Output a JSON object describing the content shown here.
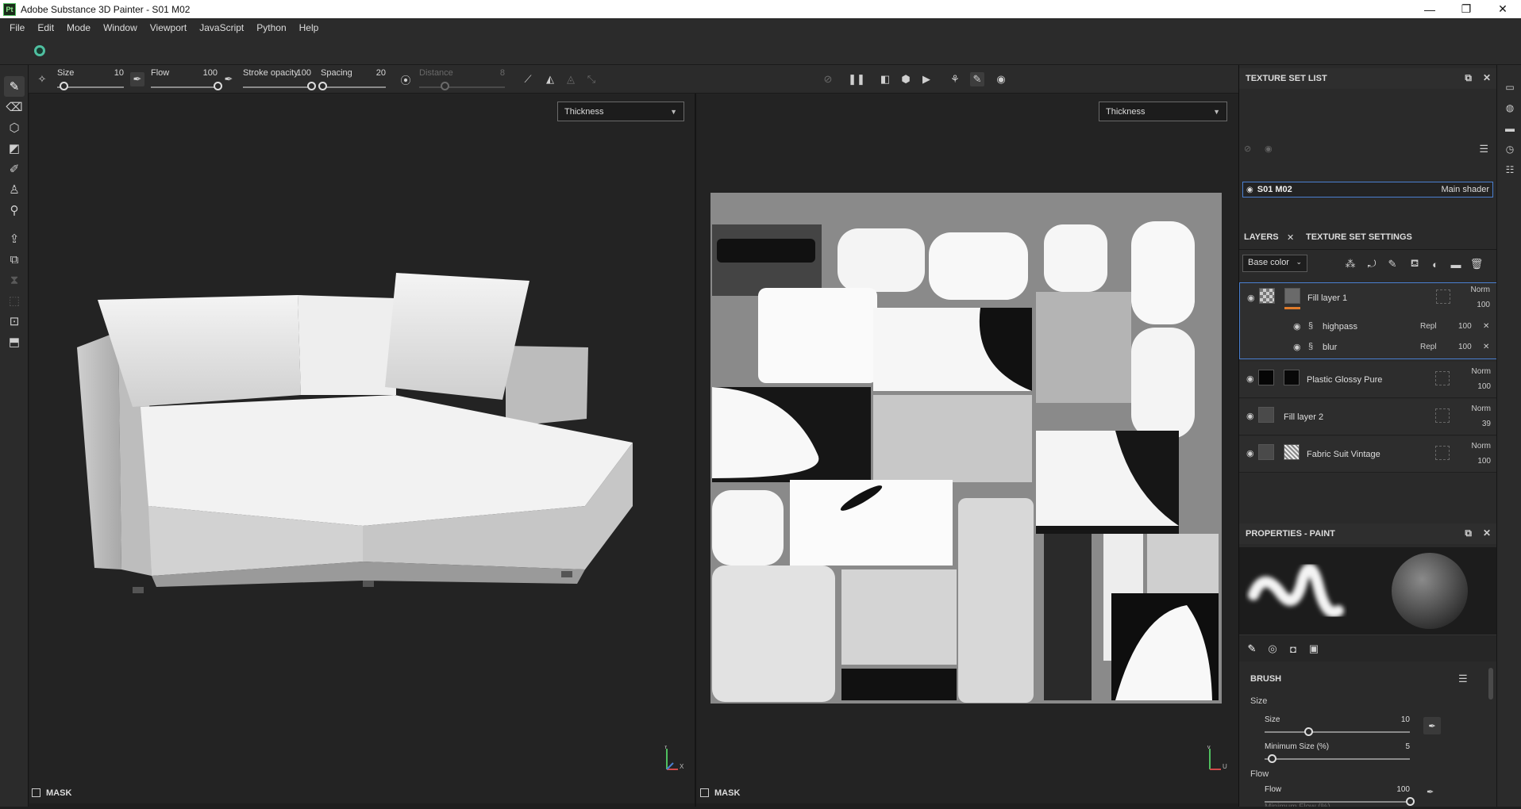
{
  "window": {
    "title": "Adobe Substance 3D Painter - S01 M02",
    "app_icon": "Pt",
    "minimize": "—",
    "maximize": "❐",
    "close": "✕"
  },
  "menu": [
    "File",
    "Edit",
    "Mode",
    "Window",
    "Viewport",
    "JavaScript",
    "Python",
    "Help"
  ],
  "toolbar": {
    "size": {
      "label": "Size",
      "value": "10",
      "level": 0.1
    },
    "flow": {
      "label": "Flow",
      "value": "100",
      "level": 1.0
    },
    "stroke_opacity": {
      "label": "Stroke opacity",
      "value": "100",
      "level": 1.0
    },
    "spacing": {
      "label": "Spacing",
      "value": "20",
      "level": 0.03
    },
    "distance": {
      "label": "Distance",
      "value": "8",
      "level": 0.3
    }
  },
  "viewports": {
    "left": {
      "channel": "Thickness",
      "mask_label": "MASK",
      "axis_y": "Y",
      "axis_x": "X"
    },
    "right": {
      "channel": "Thickness",
      "mask_label": "MASK",
      "axis_v": "V",
      "axis_u": "U"
    }
  },
  "texture_set_list": {
    "title": "TEXTURE SET LIST",
    "set_name": "S01 M02",
    "shader": "Main shader"
  },
  "layers_panel": {
    "tab_layers": "LAYERS",
    "tab_settings": "TEXTURE SET SETTINGS",
    "channel": "Base color",
    "layers": [
      {
        "name": "Fill layer 1",
        "blend": "Norm",
        "opacity": "100"
      },
      {
        "name": "Plastic Glossy Pure",
        "blend": "Norm",
        "opacity": "100"
      },
      {
        "name": "Fill layer 2",
        "blend": "Norm",
        "opacity": "39"
      },
      {
        "name": "Fabric Suit Vintage",
        "blend": "Norm",
        "opacity": "100"
      }
    ],
    "effects": [
      {
        "name": "highpass",
        "blend": "Repl",
        "opacity": "100"
      },
      {
        "name": "blur",
        "blend": "Repl",
        "opacity": "100"
      }
    ]
  },
  "properties": {
    "title": "PROPERTIES - PAINT",
    "section": "BRUSH",
    "size_group": "Size",
    "size": {
      "label": "Size",
      "value": "10",
      "level": 0.3
    },
    "min_size": {
      "label": "Minimum Size (%)",
      "value": "5",
      "level": 0.05
    },
    "flow_group": "Flow",
    "flow": {
      "label": "Flow",
      "value": "100",
      "level": 1.0
    },
    "cut_label": "Minimum Flow (%)"
  },
  "colors": {
    "accent_blue": "#4a7fd0",
    "orange_indicator": "#e07b2a",
    "teal_sync": "#4fbfa0"
  }
}
